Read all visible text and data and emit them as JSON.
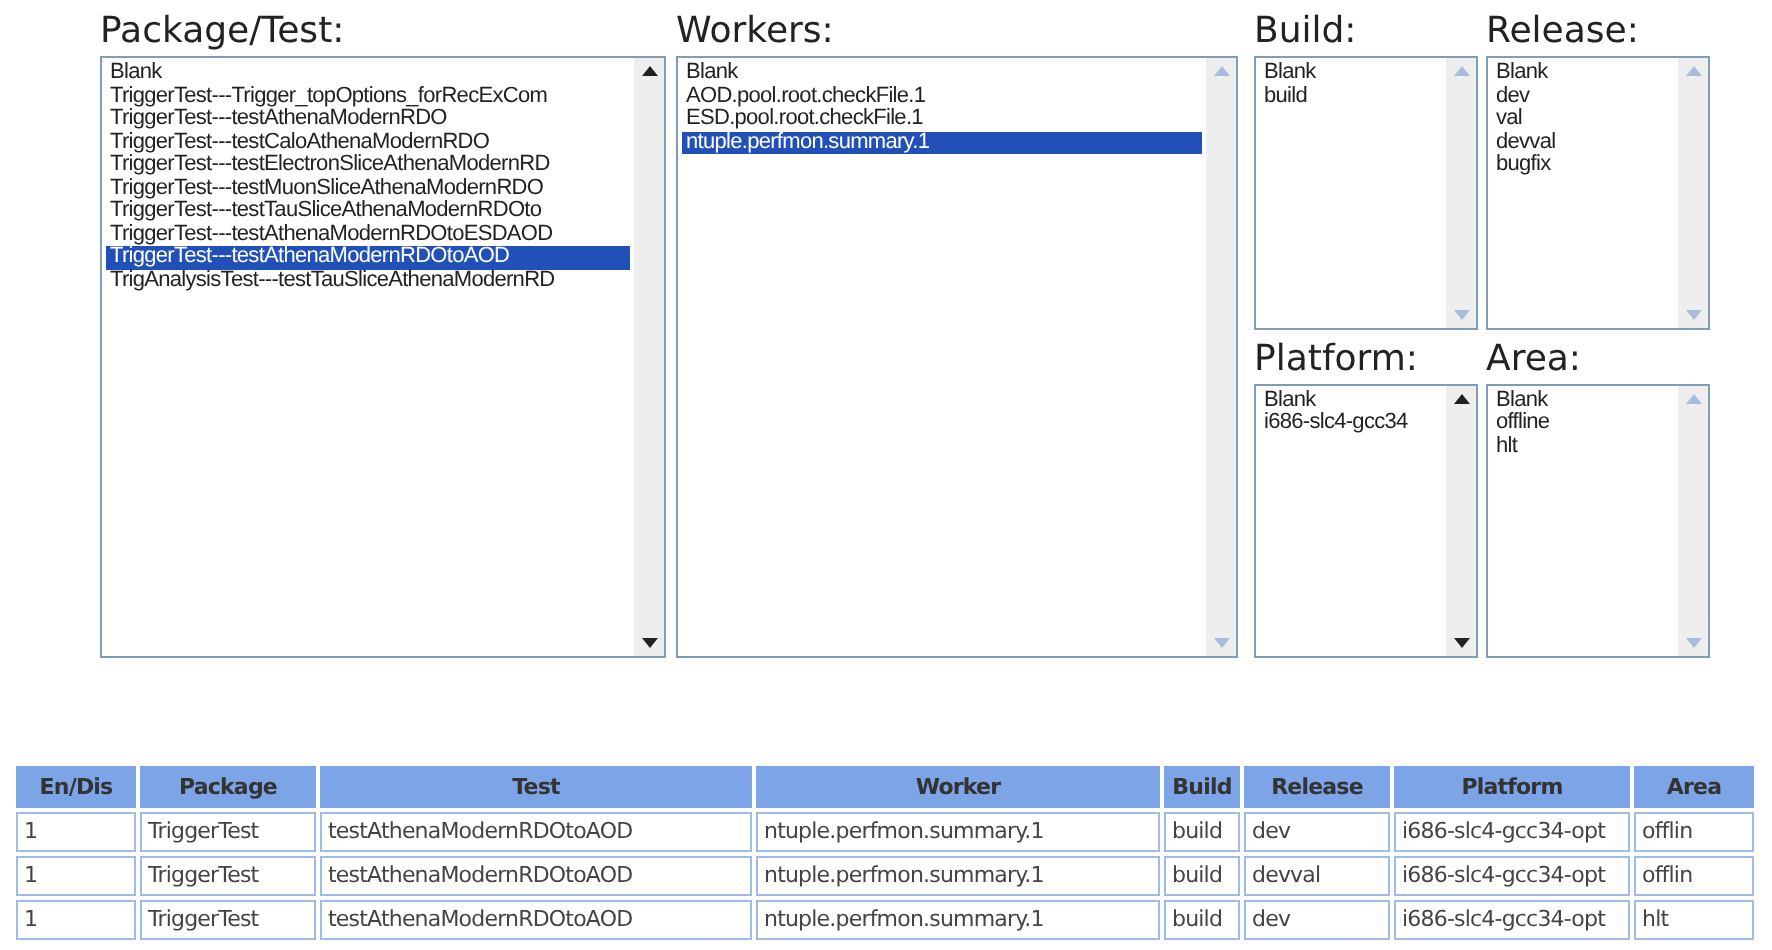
{
  "lists": [
    {
      "label": "Package/Test:",
      "scroll_enabled": true,
      "items": [
        {
          "text": "Blank",
          "selected": false
        },
        {
          "text": "TriggerTest---Trigger_topOptions_forRecExCom",
          "selected": false
        },
        {
          "text": "TriggerTest---testAthenaModernRDO",
          "selected": false
        },
        {
          "text": "TriggerTest---testCaloAthenaModernRDO",
          "selected": false
        },
        {
          "text": "TriggerTest---testElectronSliceAthenaModernRD",
          "selected": false
        },
        {
          "text": "TriggerTest---testMuonSliceAthenaModernRDO",
          "selected": false
        },
        {
          "text": "TriggerTest---testTauSliceAthenaModernRDOto",
          "selected": false
        },
        {
          "text": "TriggerTest---testAthenaModernRDOtoESDAOD",
          "selected": false
        },
        {
          "text": "TriggerTest---testAthenaModernRDOtoAOD",
          "selected": true
        },
        {
          "text": "TrigAnalysisTest---testTauSliceAthenaModernRD",
          "selected": false
        }
      ]
    },
    {
      "label": "Workers:",
      "scroll_enabled": false,
      "items": [
        {
          "text": "Blank",
          "selected": false
        },
        {
          "text": "AOD.pool.root.checkFile.1",
          "selected": false
        },
        {
          "text": "ESD.pool.root.checkFile.1",
          "selected": false
        },
        {
          "text": "ntuple.perfmon.summary.1",
          "selected": true
        }
      ]
    },
    {
      "label": "Build:",
      "scroll_enabled": false,
      "items": [
        {
          "text": "Blank",
          "selected": false
        },
        {
          "text": "build",
          "selected": false
        }
      ]
    },
    {
      "label": "Release:",
      "scroll_enabled": false,
      "items": [
        {
          "text": "Blank",
          "selected": false
        },
        {
          "text": "dev",
          "selected": false
        },
        {
          "text": "val",
          "selected": false
        },
        {
          "text": "devval",
          "selected": false
        },
        {
          "text": "bugfix",
          "selected": false
        }
      ]
    },
    {
      "label": "Platform:",
      "scroll_enabled": true,
      "items": [
        {
          "text": "Blank",
          "selected": false
        },
        {
          "text": "i686-slc4-gcc34",
          "selected": false
        }
      ]
    },
    {
      "label": "Area:",
      "scroll_enabled": false,
      "items": [
        {
          "text": "Blank",
          "selected": false
        },
        {
          "text": "offline",
          "selected": false
        },
        {
          "text": "hlt",
          "selected": false
        }
      ]
    }
  ],
  "table": {
    "columns": [
      "En/Dis",
      "Package",
      "Test",
      "Worker",
      "Build",
      "Release",
      "Platform",
      "Area"
    ],
    "rows": [
      [
        "1",
        "TriggerTest",
        "testAthenaModernRDOtoAOD",
        "ntuple.perfmon.summary.1",
        "build",
        "dev",
        "i686-slc4-gcc34-opt",
        "offlin"
      ],
      [
        "1",
        "TriggerTest",
        "testAthenaModernRDOtoAOD",
        "ntuple.perfmon.summary.1",
        "build",
        "devval",
        "i686-slc4-gcc34-opt",
        "offlin"
      ],
      [
        "1",
        "TriggerTest",
        "testAthenaModernRDOtoAOD",
        "ntuple.perfmon.summary.1",
        "build",
        "dev",
        "i686-slc4-gcc34-opt",
        "hlt"
      ]
    ]
  }
}
